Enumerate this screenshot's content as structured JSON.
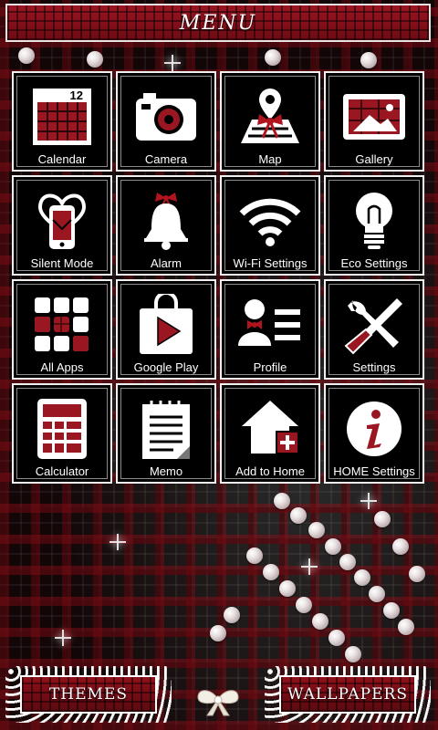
{
  "header": {
    "title": "MENU"
  },
  "apps": [
    {
      "label": "Calendar",
      "icon": "calendar-icon",
      "calendar_number": "12"
    },
    {
      "label": "Camera",
      "icon": "camera-icon"
    },
    {
      "label": "Map",
      "icon": "map-icon"
    },
    {
      "label": "Gallery",
      "icon": "gallery-icon"
    },
    {
      "label": "Silent Mode",
      "icon": "silent-mode-icon"
    },
    {
      "label": "Alarm",
      "icon": "alarm-bell-icon"
    },
    {
      "label": "Wi-Fi Settings",
      "icon": "wifi-icon"
    },
    {
      "label": "Eco Settings",
      "icon": "lightbulb-icon"
    },
    {
      "label": "All Apps",
      "icon": "all-apps-grid-icon"
    },
    {
      "label": "Google Play",
      "icon": "google-play-icon"
    },
    {
      "label": "Profile",
      "icon": "profile-icon"
    },
    {
      "label": "Settings",
      "icon": "settings-tools-icon"
    },
    {
      "label": "Calculator",
      "icon": "calculator-icon"
    },
    {
      "label": "Memo",
      "icon": "memo-icon"
    },
    {
      "label": "Add to Home",
      "icon": "add-to-home-icon"
    },
    {
      "label": "HOME Settings",
      "icon": "info-icon"
    }
  ],
  "bottom": {
    "themes_label": "THEMES",
    "wallpapers_label": "WALLPAPERS"
  },
  "colors": {
    "accent_red": "#8f101a",
    "tile_bg": "#000000",
    "border": "#f0f0f0"
  }
}
